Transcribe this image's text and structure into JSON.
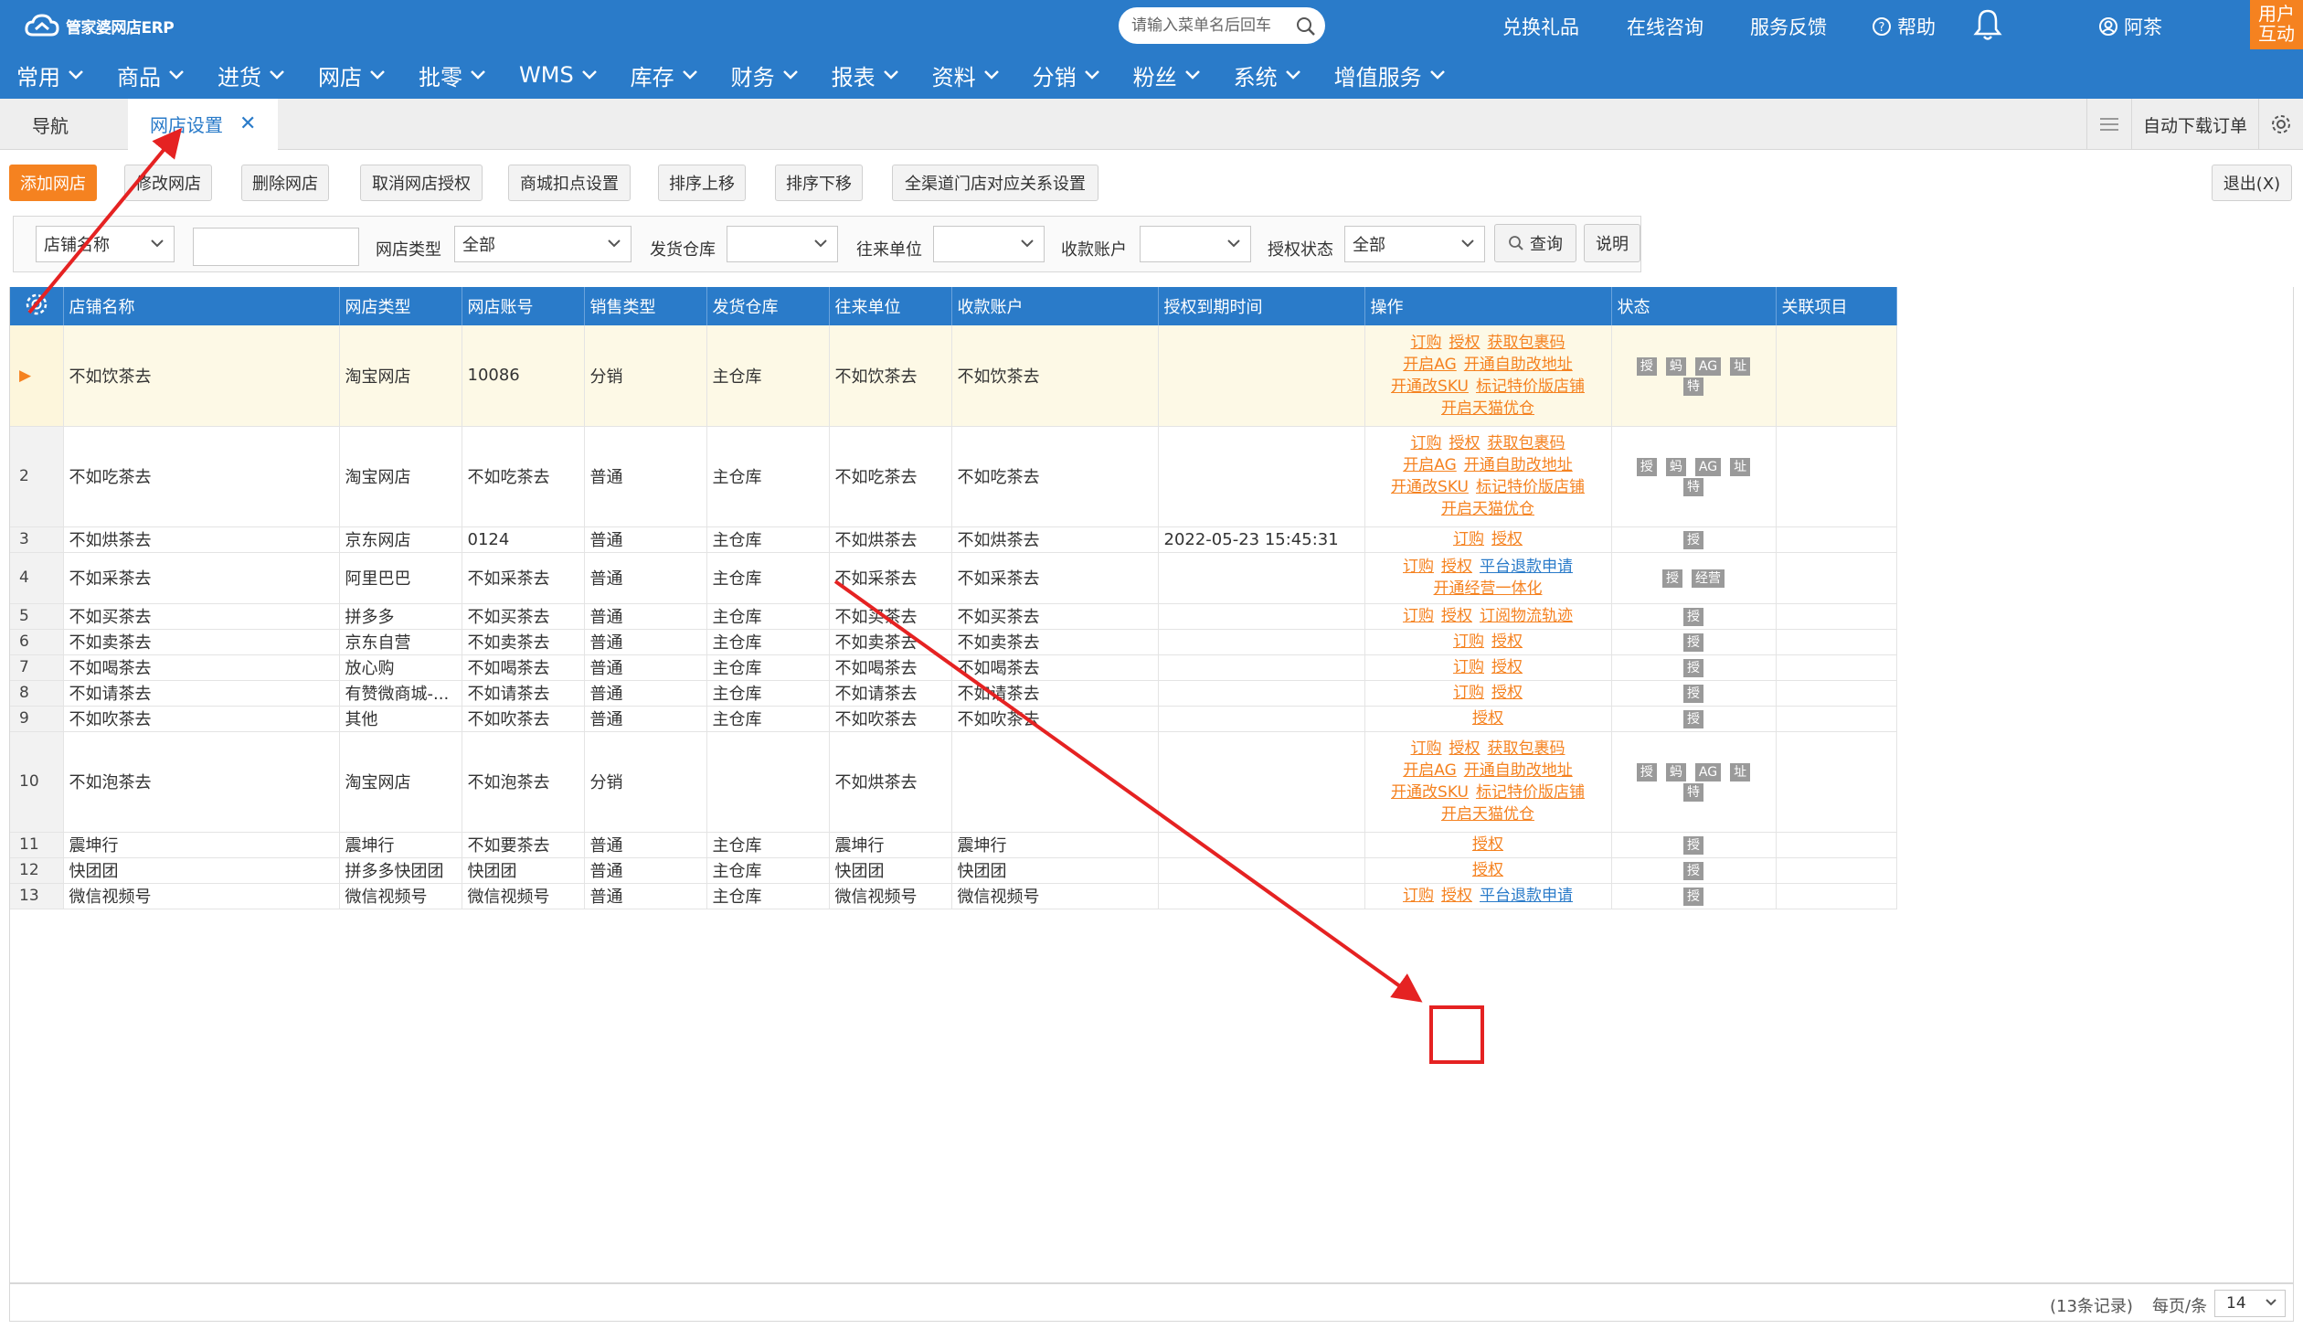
{
  "app": {
    "logo": "管家婆网店ERP",
    "search_placeholder": "请输入菜单名后回车",
    "top_links": {
      "gift": "兑换礼品",
      "consult": "在线咨询",
      "feedback": "服务反馈",
      "help": "帮助",
      "user": "阿茶"
    },
    "user_interact": [
      "用户",
      "互动"
    ]
  },
  "main_menu": [
    "常用",
    "商品",
    "进货",
    "网店",
    "批零",
    "WMS",
    "库存",
    "财务",
    "报表",
    "资料",
    "分销",
    "粉丝",
    "系统",
    "增值服务"
  ],
  "tabs": {
    "nav": "导航",
    "shop_settings": "网店设置",
    "auto_download": "自动下载订单"
  },
  "toolbar": {
    "add": "添加网店",
    "edit": "修改网店",
    "delete": "删除网店",
    "cancel_auth": "取消网店授权",
    "deduction": "商城扣点设置",
    "move_up": "排序上移",
    "move_down": "排序下移",
    "channel": "全渠道门店对应关系设置",
    "exit": "退出(X)"
  },
  "filters": {
    "field_select": "店铺名称",
    "shop_type_label": "网店类型",
    "shop_type_value": "全部",
    "warehouse_label": "发货仓库",
    "partner_label": "往来单位",
    "account_label": "收款账户",
    "auth_label": "授权状态",
    "auth_value": "全部",
    "query": "查询",
    "explain": "说明"
  },
  "columns": [
    "店铺名称",
    "网店类型",
    "网店账号",
    "销售类型",
    "发货仓库",
    "往来单位",
    "收款账户",
    "授权到期时间",
    "操作",
    "状态",
    "关联项目"
  ],
  "rows": [
    {
      "n": "▶",
      "name": "不如饮茶去",
      "type": "淘宝网店",
      "acct": "10086",
      "sale": "分销",
      "wh": "主仓库",
      "partner": "不如饮茶去",
      "pay": "不如饮茶去",
      "expire": "",
      "ops": [
        [
          "订购",
          "授权",
          "获取包裹码"
        ],
        [
          "开启AG",
          "开通自助改地址"
        ],
        [
          "开通改SKU",
          "标记特价版店铺"
        ],
        [
          "开启天猫优仓"
        ]
      ],
      "stat": [
        [
          "授",
          "蚂",
          "AG",
          "址"
        ],
        [
          "特"
        ]
      ]
    },
    {
      "n": "2",
      "name": "不如吃茶去",
      "type": "淘宝网店",
      "acct": "不如吃茶去",
      "sale": "普通",
      "wh": "主仓库",
      "partner": "不如吃茶去",
      "pay": "不如吃茶去",
      "expire": "",
      "ops": [
        [
          "订购",
          "授权",
          "获取包裹码"
        ],
        [
          "开启AG",
          "开通自助改地址"
        ],
        [
          "开通改SKU",
          "标记特价版店铺"
        ],
        [
          "开启天猫优仓"
        ]
      ],
      "stat": [
        [
          "授",
          "蚂",
          "AG",
          "址"
        ],
        [
          "特"
        ]
      ]
    },
    {
      "n": "3",
      "name": "不如烘茶去",
      "type": "京东网店",
      "acct": "0124",
      "sale": "普通",
      "wh": "主仓库",
      "partner": "不如烘茶去",
      "pay": "不如烘茶去",
      "expire": "2022-05-23 15:45:31",
      "ops": [
        [
          "订购",
          "授权"
        ]
      ],
      "stat": [
        [
          "授"
        ]
      ]
    },
    {
      "n": "4",
      "name": "不如采茶去",
      "type": "阿里巴巴",
      "acct": "不如采茶去",
      "sale": "普通",
      "wh": "主仓库",
      "partner": "不如采茶去",
      "pay": "不如采茶去",
      "expire": "",
      "ops": [
        [
          "订购",
          "授权",
          "平台退款申请"
        ],
        [
          "开通经营一体化"
        ]
      ],
      "stat": [
        [
          "授",
          "经营"
        ]
      ]
    },
    {
      "n": "5",
      "name": "不如买茶去",
      "type": "拼多多",
      "acct": "不如买茶去",
      "sale": "普通",
      "wh": "主仓库",
      "partner": "不如买茶去",
      "pay": "不如买茶去",
      "expire": "",
      "ops": [
        [
          "订购",
          "授权",
          "订阅物流轨迹"
        ]
      ],
      "stat": [
        [
          "授"
        ]
      ]
    },
    {
      "n": "6",
      "name": "不如卖茶去",
      "type": "京东自营",
      "acct": "不如卖茶去",
      "sale": "普通",
      "wh": "主仓库",
      "partner": "不如卖茶去",
      "pay": "不如卖茶去",
      "expire": "",
      "ops": [
        [
          "订购",
          "授权"
        ]
      ],
      "stat": [
        [
          "授"
        ]
      ]
    },
    {
      "n": "7",
      "name": "不如喝茶去",
      "type": "放心购",
      "acct": "不如喝茶去",
      "sale": "普通",
      "wh": "主仓库",
      "partner": "不如喝茶去",
      "pay": "不如喝茶去",
      "expire": "",
      "ops": [
        [
          "订购",
          "授权"
        ]
      ],
      "stat": [
        [
          "授"
        ]
      ]
    },
    {
      "n": "8",
      "name": "不如请茶去",
      "type": "有赞微商城-...",
      "acct": "不如请茶去",
      "sale": "普通",
      "wh": "主仓库",
      "partner": "不如请茶去",
      "pay": "不如请茶去",
      "expire": "",
      "ops": [
        [
          "订购",
          "授权"
        ]
      ],
      "stat": [
        [
          "授"
        ]
      ]
    },
    {
      "n": "9",
      "name": "不如吹茶去",
      "type": "其他",
      "acct": "不如吹茶去",
      "sale": "普通",
      "wh": "主仓库",
      "partner": "不如吹茶去",
      "pay": "不如吹茶去",
      "expire": "",
      "ops": [
        [
          "授权"
        ]
      ],
      "stat": [
        [
          "授"
        ]
      ]
    },
    {
      "n": "10",
      "name": "不如泡茶去",
      "type": "淘宝网店",
      "acct": "不如泡茶去",
      "sale": "分销",
      "wh": "",
      "partner": "不如烘茶去",
      "pay": "",
      "expire": "",
      "ops": [
        [
          "订购",
          "授权",
          "获取包裹码"
        ],
        [
          "开启AG",
          "开通自助改地址"
        ],
        [
          "开通改SKU",
          "标记特价版店铺"
        ],
        [
          "开启天猫优仓"
        ]
      ],
      "stat": [
        [
          "授",
          "蚂",
          "AG",
          "址"
        ],
        [
          "特"
        ]
      ]
    },
    {
      "n": "11",
      "name": "震坤行",
      "type": "震坤行",
      "acct": "不如要茶去",
      "sale": "普通",
      "wh": "主仓库",
      "partner": "震坤行",
      "pay": "震坤行",
      "expire": "",
      "ops": [
        [
          "授权"
        ]
      ],
      "stat": [
        [
          "授"
        ]
      ]
    },
    {
      "n": "12",
      "name": "快团团",
      "type": "拼多多快团团",
      "acct": "快团团",
      "sale": "普通",
      "wh": "主仓库",
      "partner": "快团团",
      "pay": "快团团",
      "expire": "",
      "ops": [
        [
          "授权"
        ]
      ],
      "stat": [
        [
          "授"
        ]
      ]
    },
    {
      "n": "13",
      "name": "微信视频号",
      "type": "微信视频号",
      "acct": "微信视频号",
      "sale": "普通",
      "wh": "主仓库",
      "partner": "微信视频号",
      "pay": "微信视频号",
      "expire": "",
      "ops": [
        [
          "订购",
          "授权",
          "平台退款申请"
        ]
      ],
      "stat": [
        [
          "授"
        ]
      ]
    }
  ],
  "footer": {
    "records": "(13条记录)",
    "per_page_label": "每页/条",
    "per_page": "14"
  },
  "colors": {
    "brand_blue": "#2a7bc9",
    "accent_orange": "#f58220",
    "annotation_red": "#e52222"
  }
}
